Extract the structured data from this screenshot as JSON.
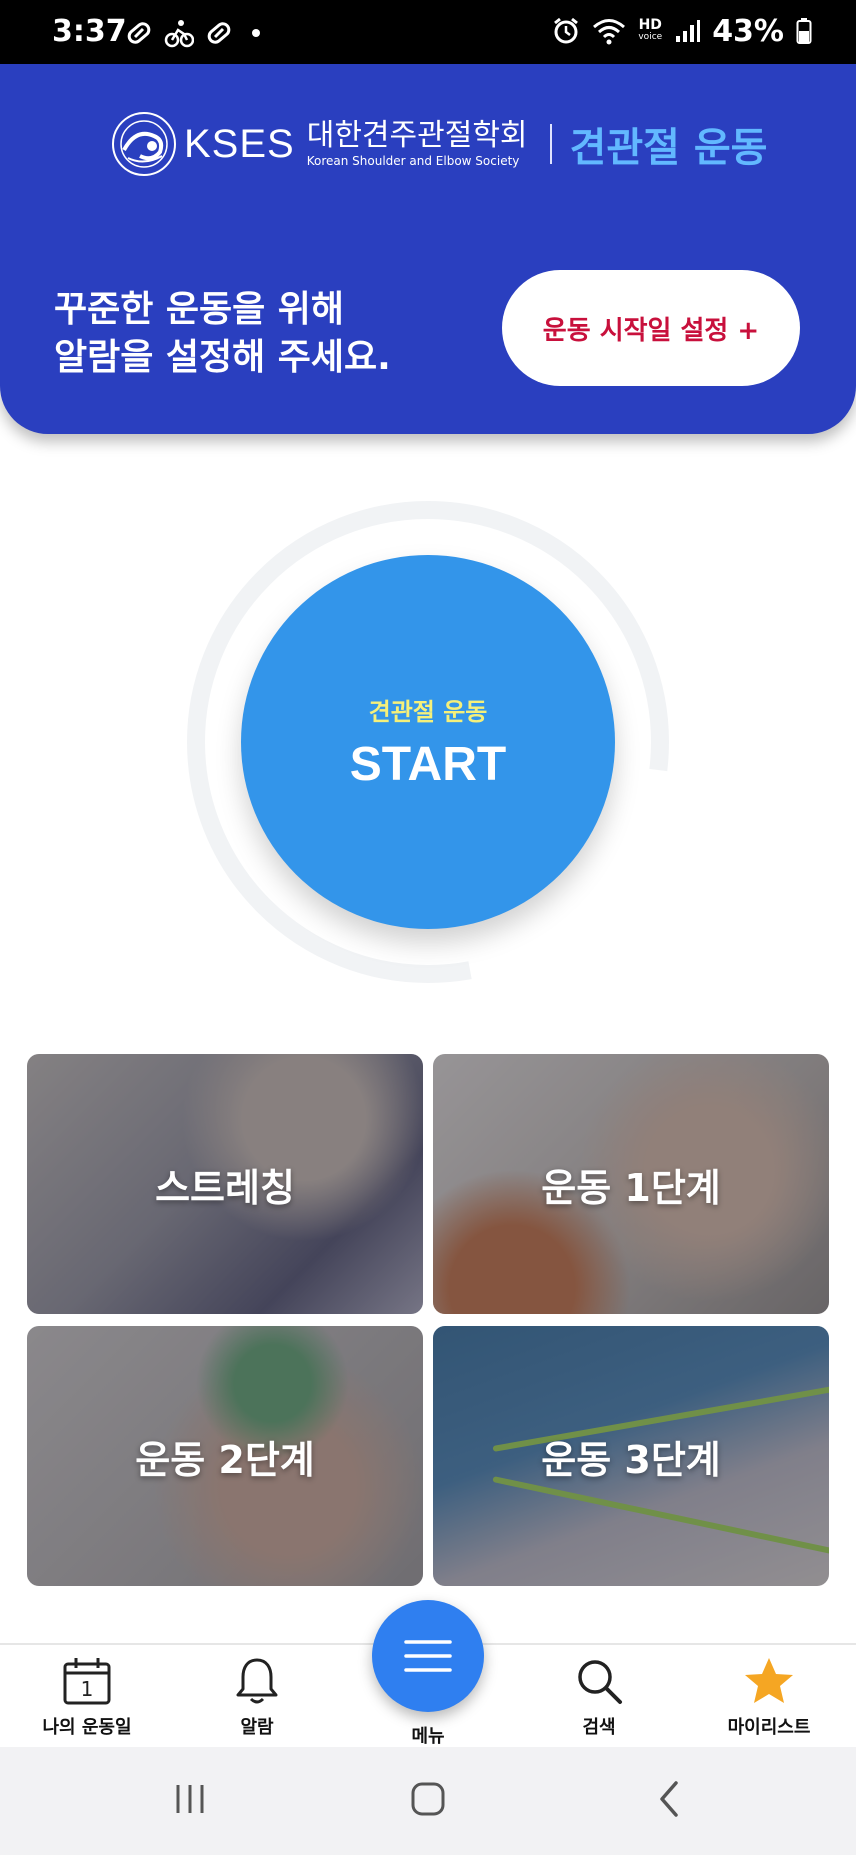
{
  "status_bar": {
    "time": "3:37",
    "hd_label": "HD",
    "hd_sub": "voice",
    "battery": "43%"
  },
  "header": {
    "logo_kses": "KSES",
    "logo_org_korean": "대한견주관절학회",
    "logo_org_english": "Korean Shoulder and Elbow Society",
    "app_title": "견관절 운동",
    "alarm_line1": "꾸준한 운동을 위해",
    "alarm_line2": "알람을 설정해 주세요.",
    "alarm_button": "운동 시작일 설정 +"
  },
  "start": {
    "subtitle": "견관절 운동",
    "title": "START"
  },
  "tiles": [
    {
      "label": "스트레칭"
    },
    {
      "label": "운동 1단계"
    },
    {
      "label": "운동 2단계"
    },
    {
      "label": "운동 3단계"
    }
  ],
  "bottom_nav": {
    "my_days": "나의 운동일",
    "calendar_day": "1",
    "alarm": "알람",
    "menu": "메뉴",
    "search": "검색",
    "mylist": "마이리스트"
  },
  "colors": {
    "header_blue": "#2a3fbf",
    "accent_light_blue": "#62b8ff",
    "start_blue": "#3395ea",
    "alarm_red": "#c8103c",
    "star_orange": "#f5a623"
  }
}
